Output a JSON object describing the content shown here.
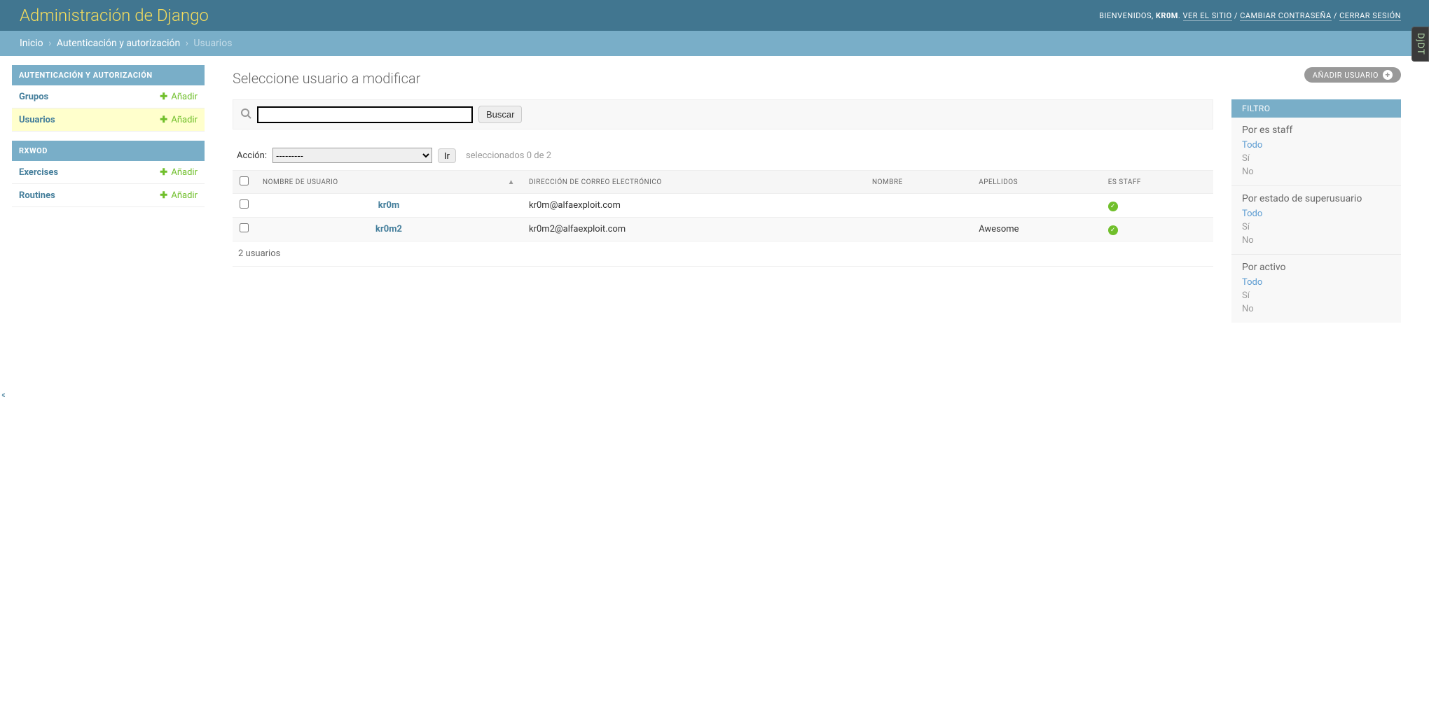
{
  "header": {
    "branding": "Administración de Django",
    "welcome_prefix": "BIENVENIDOS, ",
    "username": "KR0M",
    "view_site": "VER EL SITIO",
    "change_password": "CAMBIAR CONTRASEÑA",
    "logout": "CERRAR SESIÓN",
    "sep": " / "
  },
  "breadcrumbs": {
    "home": "Inicio",
    "app": "Autenticación y autorización",
    "current": "Usuarios",
    "sep": "›"
  },
  "sidebar": {
    "sections": [
      {
        "title": "AUTENTICACIÓN Y AUTORIZACIÓN",
        "items": [
          {
            "label": "Grupos",
            "add": "Añadir",
            "current": false
          },
          {
            "label": "Usuarios",
            "add": "Añadir",
            "current": true
          }
        ]
      },
      {
        "title": "RXWOD",
        "items": [
          {
            "label": "Exercises",
            "add": "Añadir",
            "current": false
          },
          {
            "label": "Routines",
            "add": "Añadir",
            "current": false
          }
        ]
      }
    ]
  },
  "content": {
    "title": "Seleccione usuario a modificar",
    "add_button": "AÑADIR USUARIO",
    "search_button": "Buscar",
    "search_value": "",
    "actions": {
      "label": "Acción:",
      "blank_option": "---------",
      "go": "Ir",
      "selection": "seleccionados 0 de 2"
    },
    "columns": {
      "username": "NOMBRE DE USUARIO",
      "email": "DIRECCIÓN DE CORREO ELECTRÓNICO",
      "first_name": "NOMBRE",
      "last_name": "APELLIDOS",
      "is_staff": "ES STAFF"
    },
    "rows": [
      {
        "username": "kr0m",
        "email": "kr0m@alfaexploit.com",
        "first_name": "",
        "last_name": "",
        "is_staff": true
      },
      {
        "username": "kr0m2",
        "email": "kr0m2@alfaexploit.com",
        "first_name": "",
        "last_name": "Awesome",
        "is_staff": true
      }
    ],
    "paginator": "2 usuarios"
  },
  "filter": {
    "heading": "FILTRO",
    "groups": [
      {
        "title": "Por es staff",
        "options": [
          "Todo",
          "Sí",
          "No"
        ],
        "selected": "Todo"
      },
      {
        "title": "Por estado de superusuario",
        "options": [
          "Todo",
          "Sí",
          "No"
        ],
        "selected": "Todo"
      },
      {
        "title": "Por activo",
        "options": [
          "Todo",
          "Sí",
          "No"
        ],
        "selected": "Todo"
      }
    ]
  },
  "djdt": "DjDT",
  "toggle_nav": "«"
}
